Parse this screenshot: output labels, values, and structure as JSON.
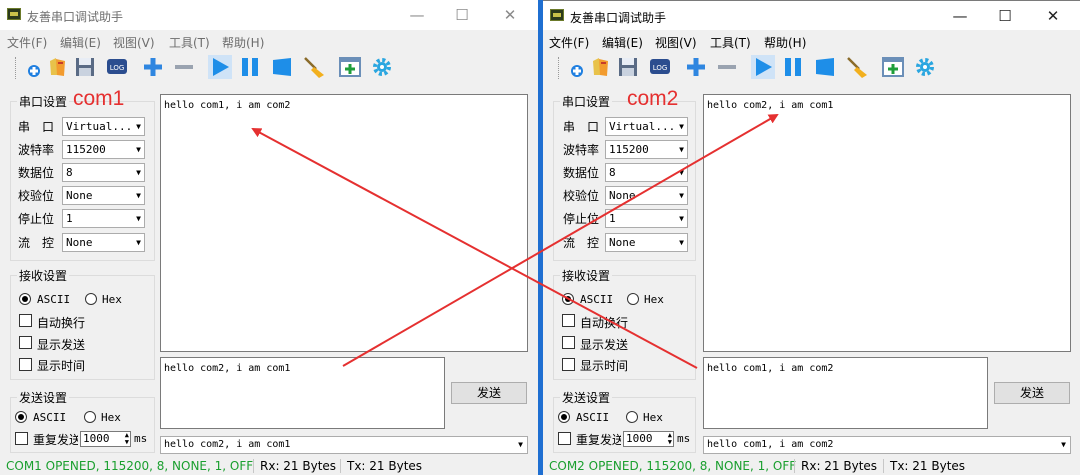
{
  "windows": [
    {
      "title": "友善串口调试助手",
      "menu": [
        "文件(F)",
        "编辑(E)",
        "视图(V)",
        "工具(T)",
        "帮助(H)"
      ],
      "annotation": "com1",
      "serial_settings": {
        "title": "串口设置",
        "port_label": "串　口",
        "port_value": "Virtual...",
        "baud_label": "波特率",
        "baud_value": "115200",
        "databits_label": "数据位",
        "databits_value": "8",
        "parity_label": "校验位",
        "parity_value": "None",
        "stopbits_label": "停止位",
        "stopbits_value": "1",
        "flow_label": "流　控",
        "flow_value": "None"
      },
      "receive_settings": {
        "title": "接收设置",
        "ascii": "ASCII",
        "hex": "Hex",
        "auto_wrap": "自动换行",
        "show_send": "显示发送",
        "show_time": "显示时间"
      },
      "send_settings": {
        "title": "发送设置",
        "ascii": "ASCII",
        "hex": "Hex",
        "repeat": "重复发送",
        "repeat_ms": "1000",
        "unit": "ms"
      },
      "receive_text": "hello com1, i am com2",
      "send_text": "hello com2, i am com1",
      "send_button": "发送",
      "history": "hello com2, i am com1",
      "status": {
        "state": "COM1 OPENED, 115200, 8, NONE, 1, OFF",
        "rx": "Rx: 21 Bytes",
        "tx": "Tx: 21 Bytes"
      }
    },
    {
      "title": "友善串口调试助手",
      "menu": [
        "文件(F)",
        "编辑(E)",
        "视图(V)",
        "工具(T)",
        "帮助(H)"
      ],
      "annotation": "com2",
      "serial_settings": {
        "title": "串口设置",
        "port_label": "串　口",
        "port_value": "Virtual...",
        "baud_label": "波特率",
        "baud_value": "115200",
        "databits_label": "数据位",
        "databits_value": "8",
        "parity_label": "校验位",
        "parity_value": "None",
        "stopbits_label": "停止位",
        "stopbits_value": "1",
        "flow_label": "流　控",
        "flow_value": "None"
      },
      "receive_settings": {
        "title": "接收设置",
        "ascii": "ASCII",
        "hex": "Hex",
        "auto_wrap": "自动换行",
        "show_send": "显示发送",
        "show_time": "显示时间"
      },
      "send_settings": {
        "title": "发送设置",
        "ascii": "ASCII",
        "hex": "Hex",
        "repeat": "重复发送",
        "repeat_ms": "1000",
        "unit": "ms"
      },
      "receive_text": "hello com2, i am com1",
      "send_text": "hello com1, i am com2",
      "send_button": "发送",
      "history": "hello com1, i am com2",
      "status": {
        "state": "COM2 OPENED, 115200, 8, NONE, 1, OFF",
        "rx": "Rx: 21 Bytes",
        "tx": "Tx: 21 Bytes"
      }
    }
  ],
  "toolbar_icons": [
    "new-icon",
    "open-icon",
    "save-icon",
    "log-icon",
    "plus-icon",
    "minus-icon",
    "play-icon",
    "pause-icon",
    "stop-icon",
    "clear-broom-icon",
    "add-window-icon",
    "settings-gear-icon"
  ],
  "colors": {
    "annotation": "#e53030",
    "status_ok": "#1a9f2e",
    "accent": "#1e8ee8"
  }
}
